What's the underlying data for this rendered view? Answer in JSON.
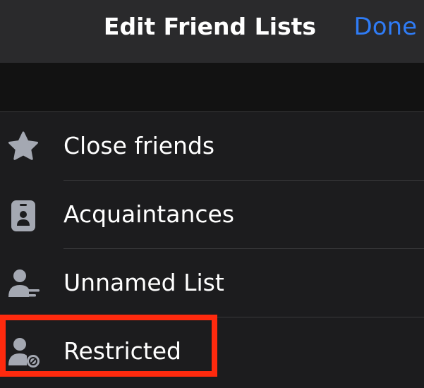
{
  "nav": {
    "title": "Edit Friend Lists",
    "done_label": "Done"
  },
  "lists": [
    {
      "label": "Close friends",
      "icon": "star-icon"
    },
    {
      "label": "Acquaintances",
      "icon": "id-badge-icon"
    },
    {
      "label": "Unnamed List",
      "icon": "person-list-icon"
    },
    {
      "label": "Restricted",
      "icon": "person-restricted-icon"
    }
  ],
  "colors": {
    "accent": "#2f7cf6",
    "highlight": "#ff2a0e",
    "icon": "#a4a8b2"
  }
}
